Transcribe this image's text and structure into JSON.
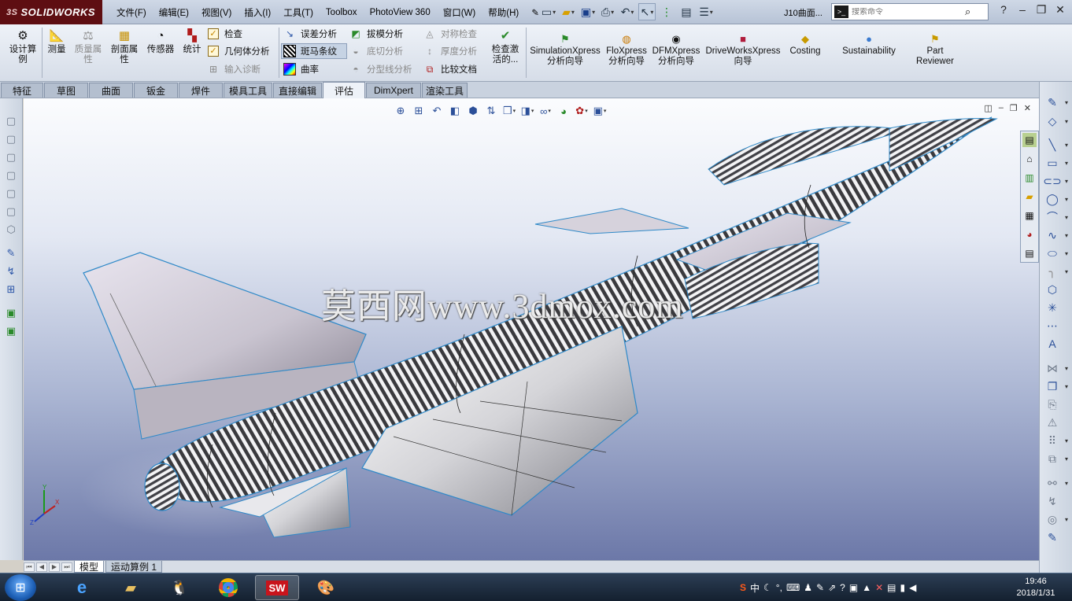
{
  "app": {
    "brand": "SOLIDWORKS",
    "brand_prefix": "3S",
    "document_title": "J10曲面...",
    "search_placeholder": "搜索命令"
  },
  "menu": [
    "文件(F)",
    "编辑(E)",
    "视图(V)",
    "插入(I)",
    "工具(T)",
    "Toolbox",
    "PhotoView 360",
    "窗口(W)",
    "帮助(H)"
  ],
  "ribbon": {
    "design_calc": "设计算例",
    "measure": "测量",
    "mass_props": "质量属性",
    "section_props": "剖面属性",
    "sensor": "传感器",
    "statistics": "统计",
    "check": "检查",
    "geometry_analysis": "几何体分析",
    "import_diagnostics": "输入诊断",
    "deviation_analysis": "误差分析",
    "zebra_stripes": "斑马条纹",
    "curvature": "曲率",
    "draft_analysis": "拔模分析",
    "undercut_analysis": "底切分析",
    "parting_line_analysis": "分型线分析",
    "symmetry_check": "对称检查",
    "thickness_analysis": "厚度分析",
    "compare_documents": "比较文档",
    "check_active": "检查激活的...",
    "simulationxpress": "SimulationXpress 分析向导",
    "floxpress": "FloXpress 分析向导",
    "dfmxpress": "DFMXpress 分析向导",
    "driveworksxpress": "DriveWorksXpress 向导",
    "costing": "Costing",
    "sustainability": "Sustainability",
    "part_reviewer": "Part Reviewer"
  },
  "tabs": [
    "特征",
    "草图",
    "曲面",
    "钣金",
    "焊件",
    "模具工具",
    "直接编辑",
    "评估",
    "DimXpert",
    "渲染工具"
  ],
  "active_tab": "评估",
  "viewport": {
    "watermark": "莫西网www.3dmox.com",
    "triad_labels": [
      "Y",
      "X",
      "Z"
    ]
  },
  "model_tabs": [
    "模型",
    "运动算例 1"
  ],
  "taskbar": {
    "time": "19:46",
    "date": "2018/1/31",
    "ime": "中"
  },
  "colors": {
    "brand": "#5e0e12",
    "model_outline": "#2f89c8"
  }
}
